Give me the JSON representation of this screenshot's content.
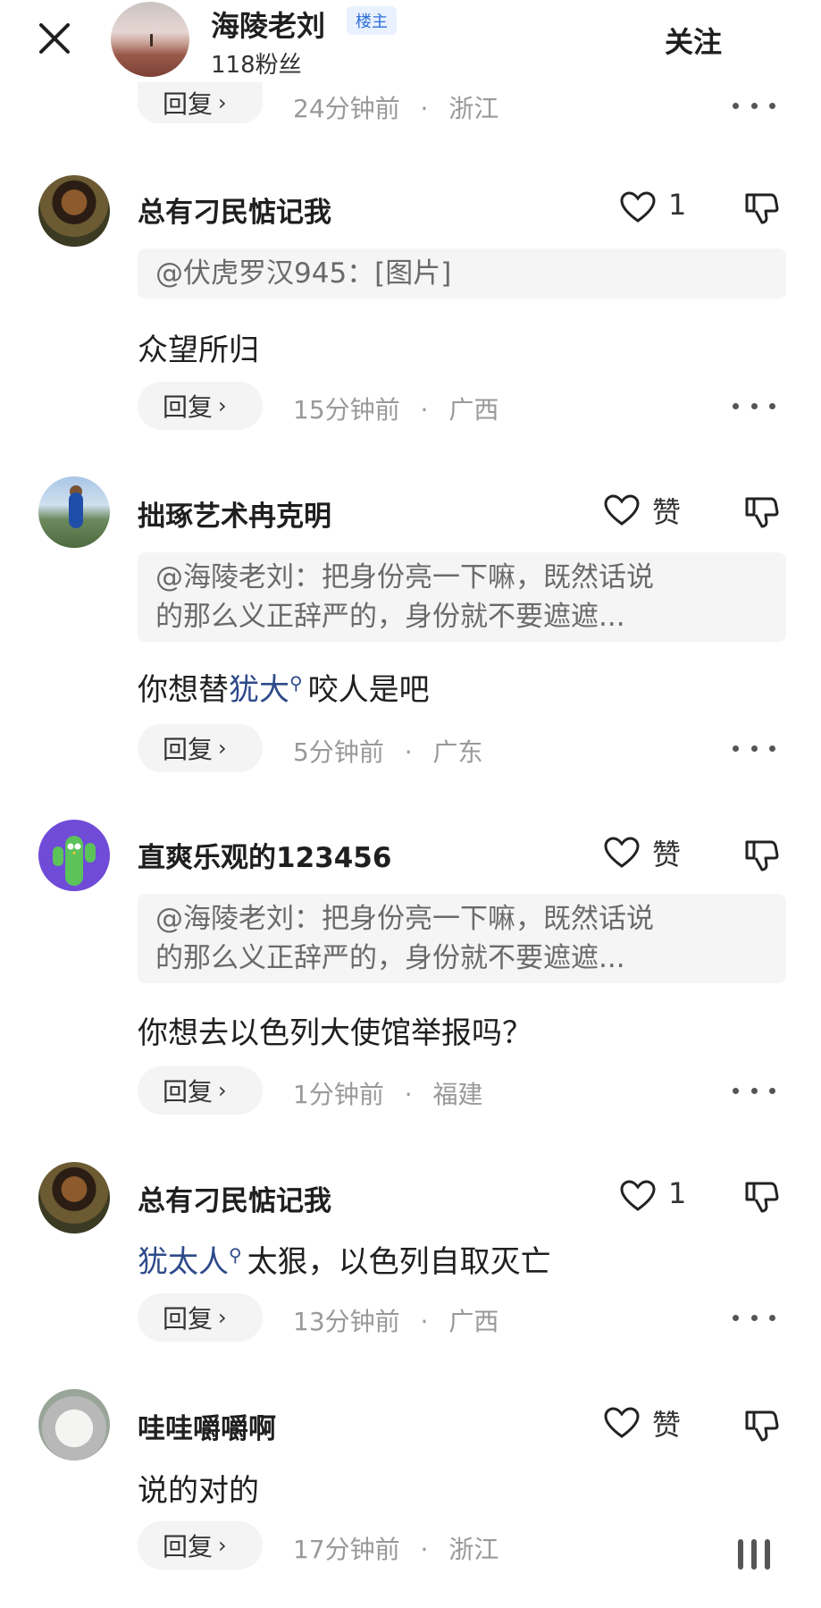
{
  "header": {
    "poster_name": "海陵老刘",
    "poster_badge": "楼主",
    "poster_fans": "118粉丝",
    "follow_label": "关注"
  },
  "reply_label": "回复",
  "top_meta": {
    "time": "24分钟前",
    "sep": "·",
    "location": "浙江"
  },
  "comments": [
    {
      "username": "总有刁民惦记我",
      "like_count": "1",
      "quote": [
        "@伏虎罗汉945：[图片]"
      ],
      "body_prefix": "",
      "body_link": "",
      "body_suffix": "众望所归",
      "time": "15分钟前",
      "sep": "·",
      "location": "广西"
    },
    {
      "username": "拙琢艺术冉克明",
      "like_count": "赞",
      "quote": [
        "@海陵老刘：把身份亮一下嘛，既然话说",
        "的那么义正辞严的，身份就不要遮遮..."
      ],
      "body_prefix": "你想替",
      "body_link": "犹大",
      "body_suffix": "咬人是吧",
      "time": "5分钟前",
      "sep": "·",
      "location": "广东"
    },
    {
      "username": "直爽乐观的123456",
      "like_count": "赞",
      "quote": [
        "@海陵老刘：把身份亮一下嘛，既然话说",
        "的那么义正辞严的，身份就不要遮遮..."
      ],
      "body_prefix": "",
      "body_link": "",
      "body_suffix": "你想去以色列大使馆举报吗？",
      "time": "1分钟前",
      "sep": "·",
      "location": "福建"
    },
    {
      "username": "总有刁民惦记我",
      "like_count": "1",
      "quote": [],
      "body_prefix": "",
      "body_link": "犹太人",
      "body_suffix": "太狠，以色列自取灭亡",
      "time": "13分钟前",
      "sep": "·",
      "location": "广西"
    },
    {
      "username": "哇哇嚼嚼啊",
      "like_count": "赞",
      "quote": [],
      "body_prefix": "",
      "body_link": "",
      "body_suffix": "说的对的",
      "time": "17分钟前",
      "sep": "·",
      "location": "浙江"
    }
  ],
  "icons": {
    "close": "close-icon",
    "like": "heart-icon",
    "dislike": "thumbs-down-icon",
    "more": "more-dots-icon",
    "search": "search-icon"
  }
}
